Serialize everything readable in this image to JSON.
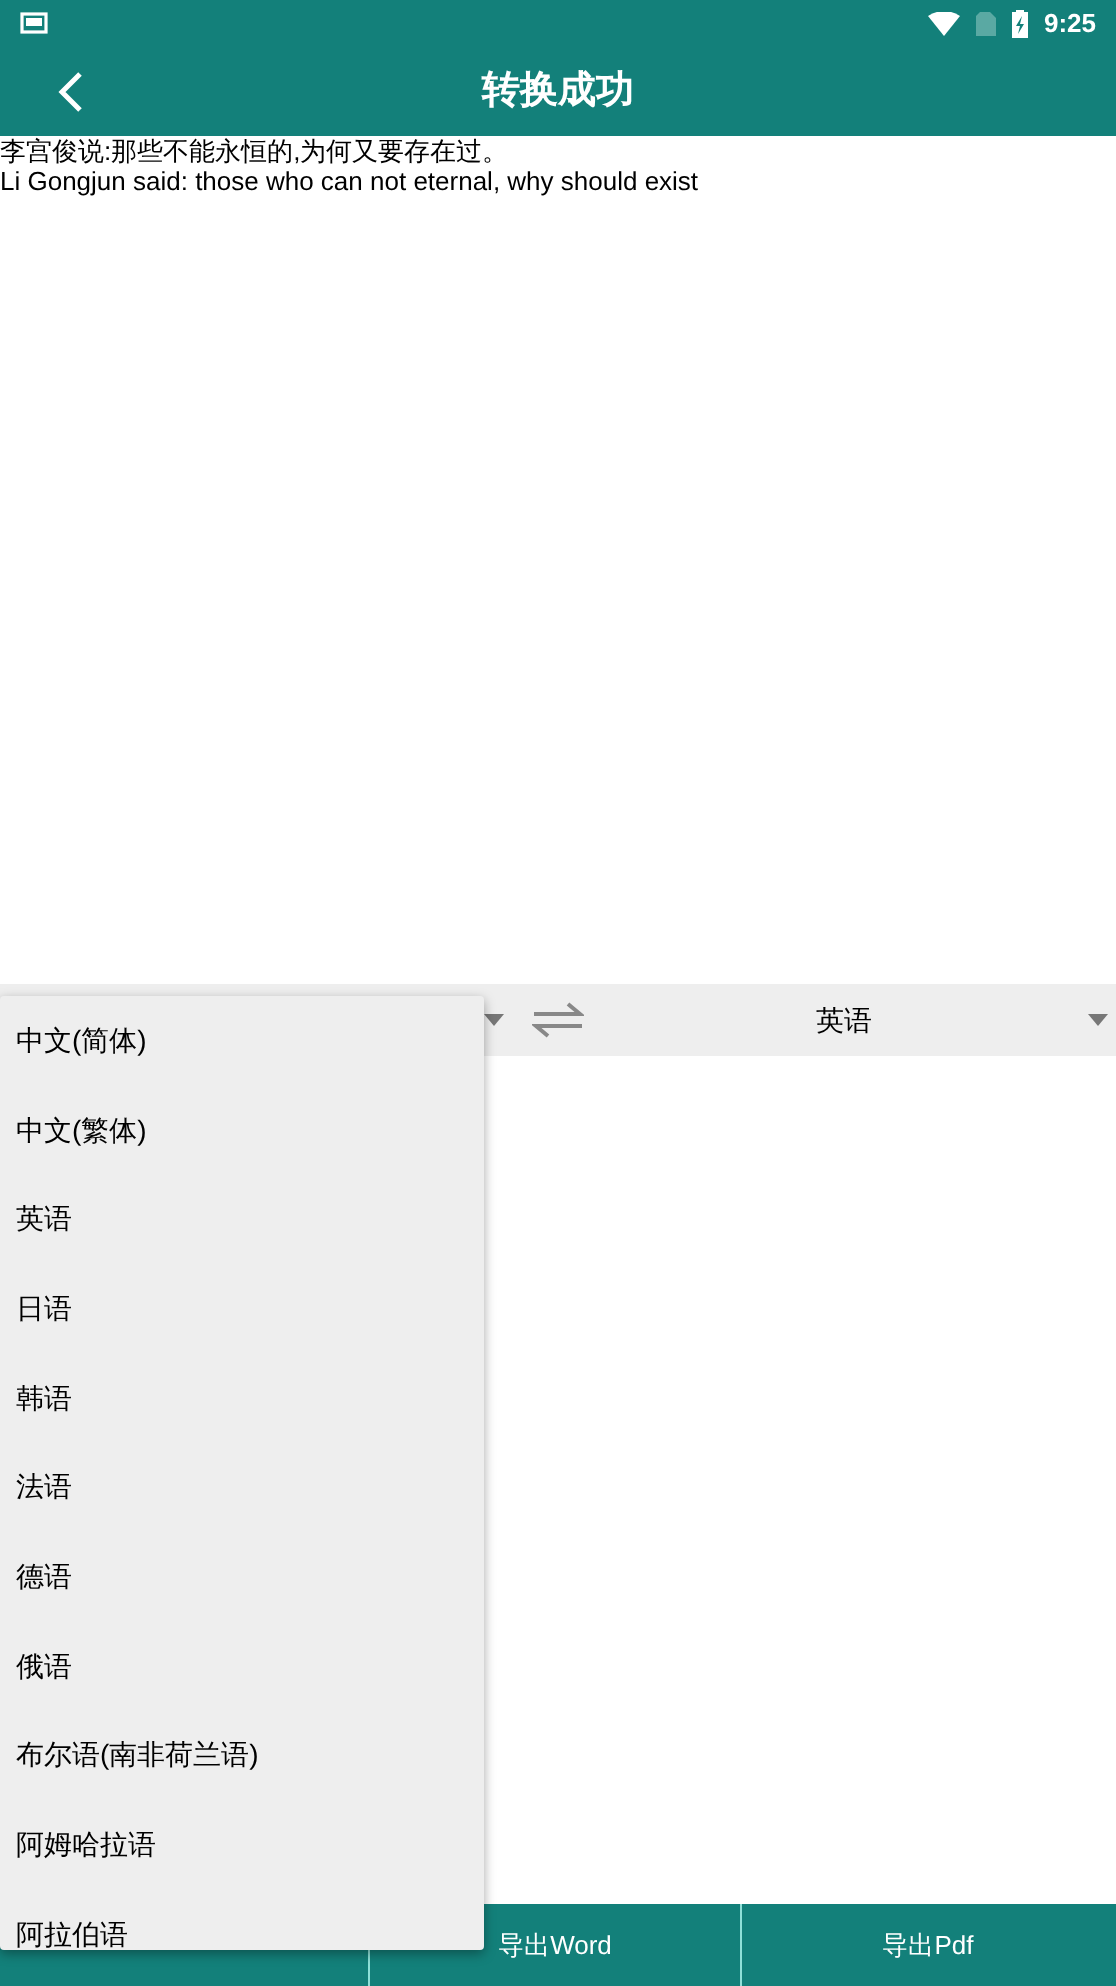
{
  "status_bar": {
    "time": "9:25"
  },
  "toolbar": {
    "title": "转换成功"
  },
  "source_text": [
    "李宫俊说:那些不能永恒的,为何又要存在过。",
    "Li Gongjun said: those who can not eternal, why should exist"
  ],
  "language_bar": {
    "target": "英语"
  },
  "dropdown": {
    "items": [
      {
        "label": "中文(简体)"
      },
      {
        "label": "中文(繁体)"
      },
      {
        "label": "英语"
      },
      {
        "label": "日语"
      },
      {
        "label": "韩语"
      },
      {
        "label": "法语"
      },
      {
        "label": "德语"
      },
      {
        "label": "俄语"
      },
      {
        "label": "布尔语(南非荷兰语)"
      },
      {
        "label": "阿姆哈拉语"
      },
      {
        "label": "阿拉伯语"
      }
    ]
  },
  "bottom_bar": {
    "buttons": [
      {
        "label": "导出Word"
      },
      {
        "label": "导出Pdf"
      }
    ]
  }
}
